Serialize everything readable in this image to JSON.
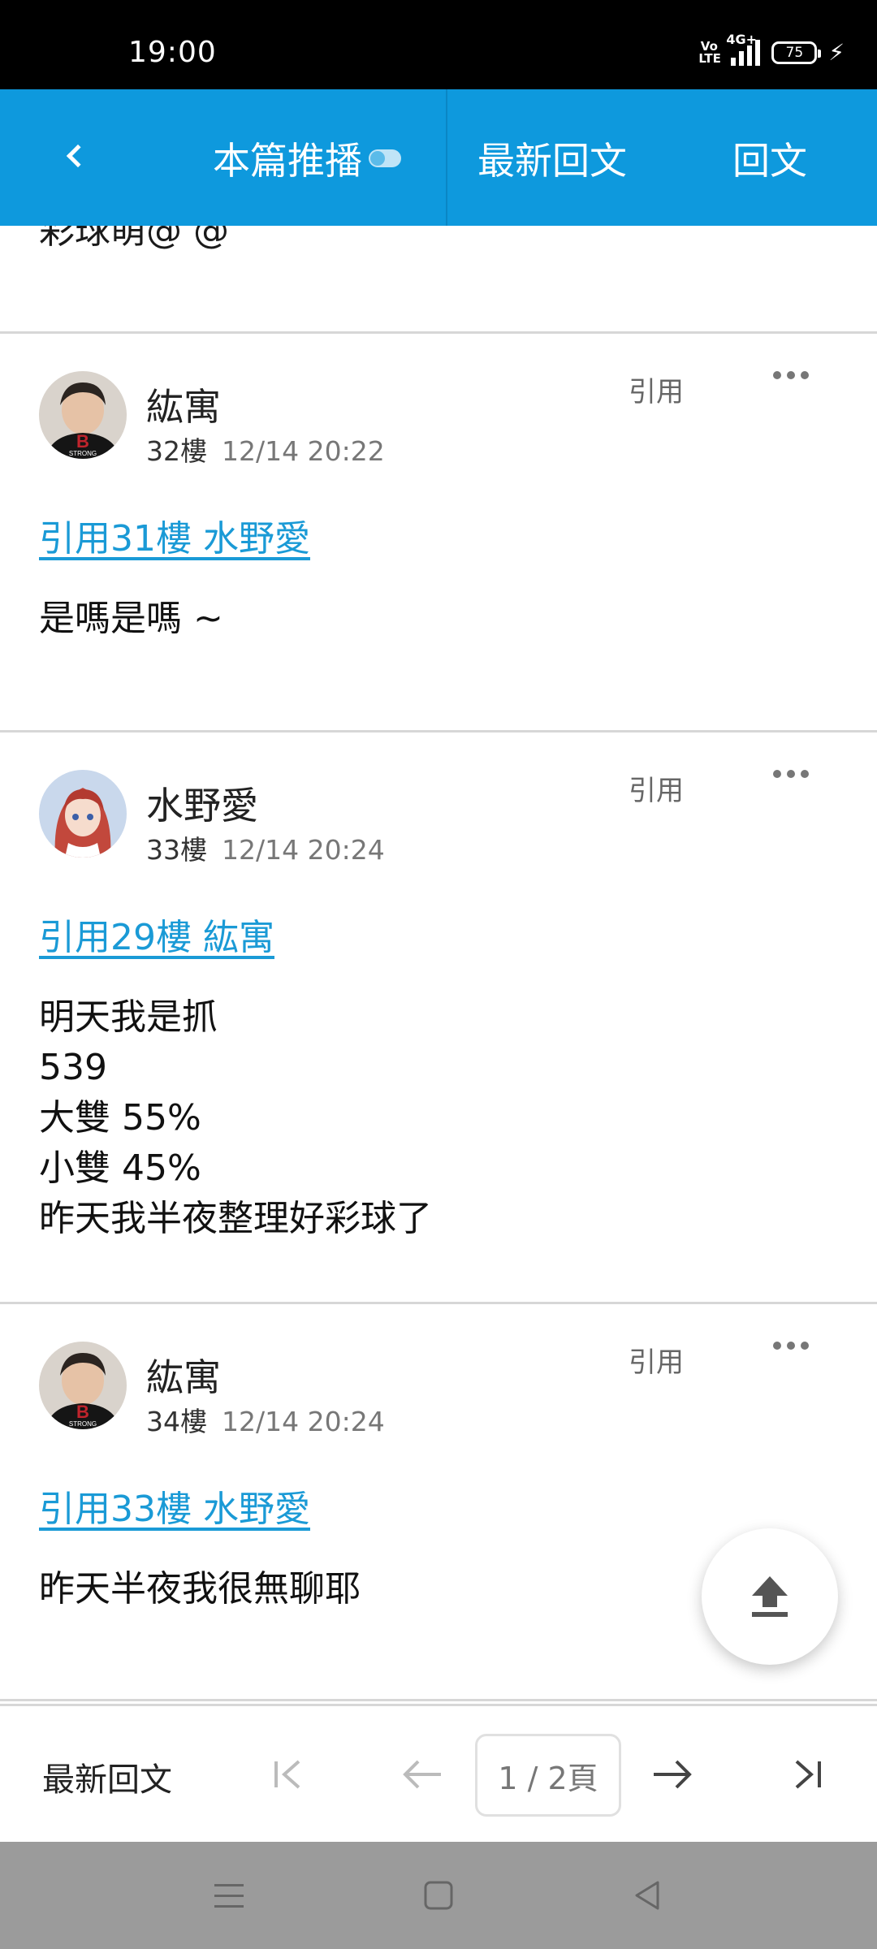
{
  "status_bar": {
    "time": "19:00",
    "volte": "Vo\nLTE",
    "network": "4G+",
    "battery": "75"
  },
  "header": {
    "title": "本篇推播",
    "latest": "最新回文",
    "reply": "回文"
  },
  "partial_text": "彩球萌@ @",
  "posts": [
    {
      "author": "紘寓",
      "floor": "32樓",
      "time": "12/14 20:22",
      "quote_action": "引用",
      "quote_link": "引用31樓 水野愛",
      "body": "是嗎是嗎 ~"
    },
    {
      "author": "水野愛",
      "floor": "33樓",
      "time": "12/14 20:24",
      "quote_action": "引用",
      "quote_link": "引用29樓 紘寓",
      "body": "明天我是抓\n539\n大雙 55%\n小雙 45%\n昨天我半夜整理好彩球了"
    },
    {
      "author": "紘寓",
      "floor": "34樓",
      "time": "12/14 20:24",
      "quote_action": "引用",
      "quote_link": "引用33樓 水野愛",
      "body": "昨天半夜我很無聊耶"
    }
  ],
  "avatar_text": "STRONG",
  "pager": {
    "latest": "最新回文",
    "page": "1 / 2頁"
  },
  "colors": {
    "header": "#0e99dd",
    "link": "#1a9ad6",
    "status_bar": "#000000",
    "nav_bar": "#9b9b9b"
  },
  "icons": [
    "back-icon",
    "toggle-icon",
    "more-icon",
    "upload-icon",
    "first-page-icon",
    "prev-page-icon",
    "next-page-icon",
    "last-page-icon",
    "menu-icon",
    "home-icon",
    "back-nav-icon"
  ]
}
